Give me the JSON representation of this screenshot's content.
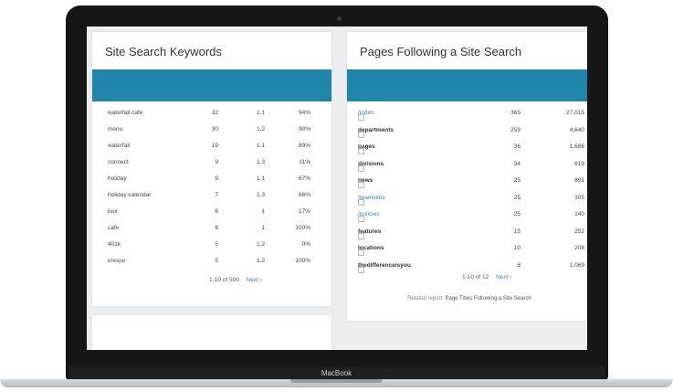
{
  "device": {
    "brand": "MacBook"
  },
  "left_panel": {
    "title": "Site Search Keywords",
    "rows": [
      {
        "keyword": "waterfall cafe",
        "searches": "32",
        "depth": "1.1",
        "exits": "94%"
      },
      {
        "keyword": "menu",
        "searches": "30",
        "depth": "1.2",
        "exits": "90%"
      },
      {
        "keyword": "waterfall",
        "searches": "19",
        "depth": "1.1",
        "exits": "89%"
      },
      {
        "keyword": "connect",
        "searches": "9",
        "depth": "1.3",
        "exits": "11%"
      },
      {
        "keyword": "holiday",
        "searches": "9",
        "depth": "1.1",
        "exits": "67%"
      },
      {
        "keyword": "holiday calendar",
        "searches": "7",
        "depth": "1.3",
        "exits": "86%"
      },
      {
        "keyword": "box",
        "searches": "6",
        "depth": "1",
        "exits": "17%"
      },
      {
        "keyword": "cafe",
        "searches": "6",
        "depth": "1",
        "exits": "100%"
      },
      {
        "keyword": "401k",
        "searches": "5",
        "depth": "1.2",
        "exits": "0%"
      },
      {
        "keyword": "crespo",
        "searches": "5",
        "depth": "1.2",
        "exits": "100%"
      }
    ],
    "pagination": {
      "range": "1-10 of 500",
      "next": "Next ›"
    }
  },
  "right_panel": {
    "title": "Pages Following a Site Search",
    "rows": [
      {
        "page": "/index",
        "v1": "365",
        "v2": "27,015",
        "style": "link"
      },
      {
        "page": "departments",
        "v1": "259",
        "v2": "4,640",
        "style": "bold"
      },
      {
        "page": "pages",
        "v1": "36",
        "v2": "1,686",
        "style": "bold"
      },
      {
        "page": "divisions",
        "v1": "34",
        "v2": "619",
        "style": "bold"
      },
      {
        "page": "news",
        "v1": "25",
        "v2": "891",
        "style": "bold"
      },
      {
        "page": "/teamsites",
        "v1": "25",
        "v2": "305",
        "style": "link"
      },
      {
        "page": "/policies",
        "v1": "25",
        "v2": "140",
        "style": "link"
      },
      {
        "page": "features",
        "v1": "15",
        "v2": "252",
        "style": "bold"
      },
      {
        "page": "locations",
        "v1": "10",
        "v2": "208",
        "style": "bold"
      },
      {
        "page": "thedifferenceisyou",
        "v1": "8",
        "v2": "1,069",
        "style": "bold"
      }
    ],
    "pagination": {
      "range": "1-10 of 12",
      "next": "Next ›"
    },
    "related_label": "Related report:",
    "related_link": "Page Titles Following a Site Search"
  },
  "colors": {
    "header_bar": "#1f86aa",
    "link": "#3b83b8"
  }
}
